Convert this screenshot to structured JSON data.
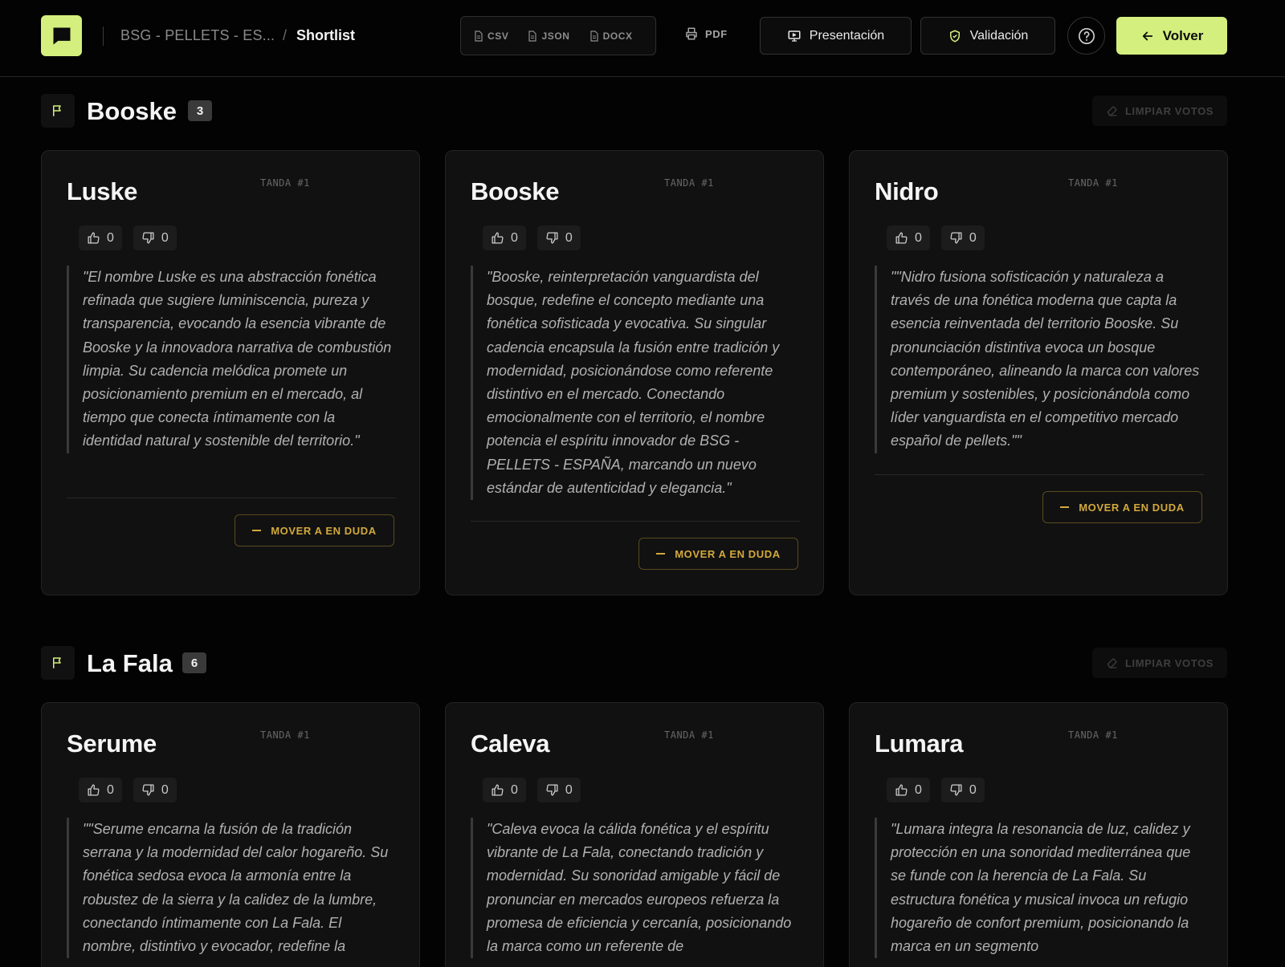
{
  "header": {
    "project": "BSG - PELLETS - ES...",
    "separator": "/",
    "current": "Shortlist",
    "exports": [
      {
        "label": "CSV",
        "icon": "file-icon"
      },
      {
        "label": "JSON",
        "icon": "file-icon"
      },
      {
        "label": "DOCX",
        "icon": "file-icon"
      }
    ],
    "pdf_label": "PDF",
    "presentation_label": "Presentación",
    "validation_label": "Validación",
    "back_label": "Volver"
  },
  "colors": {
    "accent": "#d4ef7e",
    "warning": "#d3a93d",
    "background": "#030303",
    "card": "#111111"
  },
  "sections": [
    {
      "title": "Booske",
      "count": "3",
      "clear_label": "LIMPIAR VOTOS",
      "cards": [
        {
          "name": "Luske",
          "tanda": "TANDA #1",
          "up": "0",
          "down": "0",
          "quote": "\"El nombre Luske es una abstracción fonética refinada que sugiere luminiscencia, pureza y transparencia, evocando la esencia vibrante de Booske y la innovadora narrativa de combustión limpia. Su cadencia melódica promete un posicionamiento premium en el mercado, al tiempo que conecta íntimamente con la identidad natural y sostenible del territorio.\"",
          "move_label": "MOVER A EN DUDA"
        },
        {
          "name": "Booske",
          "tanda": "TANDA #1",
          "up": "0",
          "down": "0",
          "quote": "\"Booske, reinterpretación vanguardista del bosque, redefine el concepto mediante una fonética sofisticada y evocativa. Su singular cadencia encapsula la fusión entre tradición y modernidad, posicionándose como referente distintivo en el mercado. Conectando emocionalmente con el territorio, el nombre potencia el espíritu innovador de BSG - PELLETS - ESPAÑA, marcando un nuevo estándar de autenticidad y elegancia.\"",
          "move_label": "MOVER A EN DUDA"
        },
        {
          "name": "Nidro",
          "tanda": "TANDA #1",
          "up": "0",
          "down": "0",
          "quote": "\"\"Nidro fusiona sofisticación y naturaleza a través de una fonética moderna que capta la esencia reinventada del territorio Booske. Su pronunciación distintiva evoca un bosque contemporáneo, alineando la marca con valores premium y sostenibles, y posicionándola como líder vanguardista en el competitivo mercado español de pellets.\"\"",
          "move_label": "MOVER A EN DUDA"
        }
      ]
    },
    {
      "title": "La Fala",
      "count": "6",
      "clear_label": "LIMPIAR VOTOS",
      "cards": [
        {
          "name": "Serume",
          "tanda": "TANDA #1",
          "up": "0",
          "down": "0",
          "quote": "\"\"Serume encarna la fusión de la tradición serrana y la modernidad del calor hogareño. Su fonética sedosa evoca la armonía entre la robustez de la sierra y la calidez de la lumbre, conectando íntimamente con La Fala. El nombre, distintivo y evocador, redefine la",
          "move_label": "MOVER A EN DUDA"
        },
        {
          "name": "Caleva",
          "tanda": "TANDA #1",
          "up": "0",
          "down": "0",
          "quote": "\"Caleva evoca la cálida fonética y el espíritu vibrante de La Fala, conectando tradición y modernidad. Su sonoridad amigable y fácil de pronunciar en mercados europeos refuerza la promesa de eficiencia y cercanía, posicionando la marca como un referente de",
          "move_label": "MOVER A EN DUDA"
        },
        {
          "name": "Lumara",
          "tanda": "TANDA #1",
          "up": "0",
          "down": "0",
          "quote": "\"Lumara integra la resonancia de luz, calidez y protección en una sonoridad mediterránea que se funde con la herencia de La Fala. Su estructura fonética y musical invoca un refugio hogareño de confort premium, posicionando la marca en un segmento",
          "move_label": "MOVER A EN DUDA"
        }
      ]
    }
  ]
}
